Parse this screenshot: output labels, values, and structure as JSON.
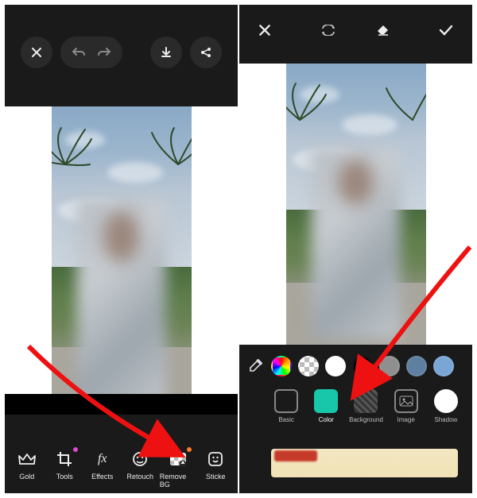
{
  "left": {
    "toolbar": {
      "close": "✕",
      "undo": "↶",
      "redo": "↷",
      "download": "⬇",
      "share": "⋔"
    },
    "tools": [
      {
        "id": "gold",
        "label": "Gold",
        "icon": "crown"
      },
      {
        "id": "tools",
        "label": "Tools",
        "icon": "crop",
        "badge": "pink"
      },
      {
        "id": "effects",
        "label": "Effects",
        "icon": "fx"
      },
      {
        "id": "retouch",
        "label": "Retouch",
        "icon": "face"
      },
      {
        "id": "removebg",
        "label": "Remove BG",
        "icon": "checker",
        "badge": "orange"
      },
      {
        "id": "sticker",
        "label": "Sticke",
        "icon": "smile"
      }
    ]
  },
  "right": {
    "toolbar": {
      "close": "✕",
      "cycle": "⇄",
      "erase": "◇",
      "confirm": "✓"
    },
    "colors": [
      {
        "id": "eyedropper",
        "type": "eyedropper"
      },
      {
        "id": "rainbow",
        "type": "rainbow"
      },
      {
        "id": "transparent",
        "type": "checker"
      },
      {
        "id": "white",
        "hex": "#ffffff"
      },
      {
        "id": "black",
        "hex": "#000000"
      },
      {
        "id": "grey",
        "hex": "#8f8f8f"
      },
      {
        "id": "steel",
        "hex": "#5f7fa0"
      },
      {
        "id": "sky",
        "hex": "#7aa6d6"
      }
    ],
    "options": [
      {
        "id": "basic",
        "label": "Basic"
      },
      {
        "id": "color",
        "label": "Color",
        "selected": true
      },
      {
        "id": "background",
        "label": "Background"
      },
      {
        "id": "image",
        "label": "Image"
      },
      {
        "id": "shadow",
        "label": "Shadow"
      }
    ]
  }
}
